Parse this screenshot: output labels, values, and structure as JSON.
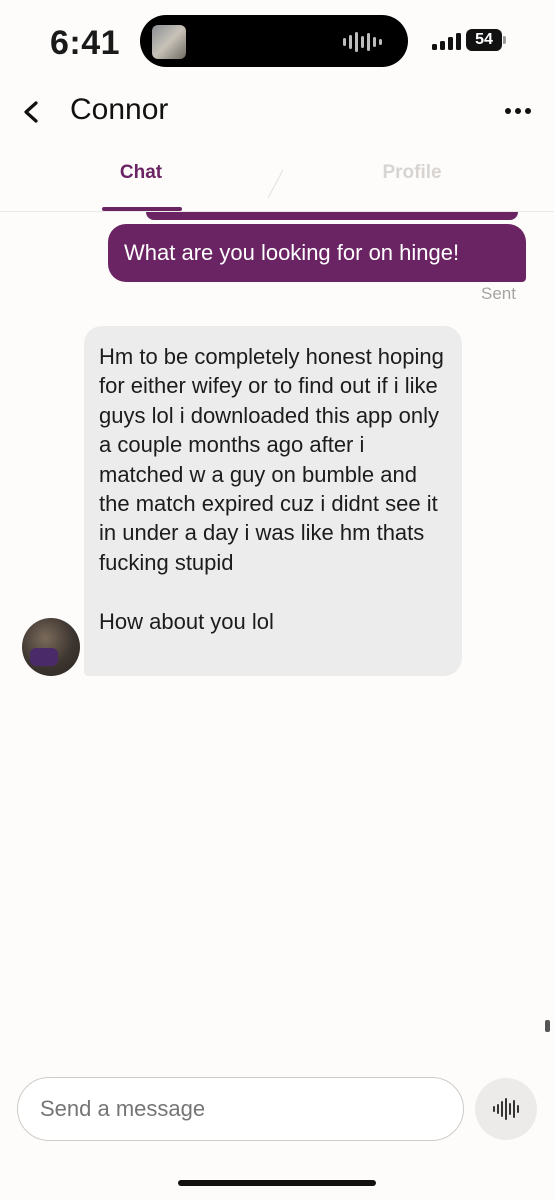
{
  "status_bar": {
    "time": "6:41",
    "battery": "54"
  },
  "header": {
    "back_icon": "chevron-left-icon",
    "contact_name": "Connor",
    "more_icon": "ellipsis-icon"
  },
  "tabs": [
    {
      "label": "Chat",
      "active": true
    },
    {
      "label": "Profile",
      "active": false
    }
  ],
  "messages": {
    "sent": {
      "text": "What are you looking for on hinge!",
      "status": "Sent"
    },
    "received": {
      "text": "Hm to be completely honest hoping for either wifey or to find out if i like guys lol i downloaded this app only a couple months ago after i matched w a guy on bumble and the match expired cuz i didnt see it in under a day i was like hm thats fucking stupid\n\nHow about you lol"
    }
  },
  "composer": {
    "placeholder": "Send a message",
    "voice_icon": "voice-waveform-icon"
  },
  "colors": {
    "accent": "#6b2463",
    "received_bubble": "#ececec",
    "background": "#fdfcfb"
  }
}
